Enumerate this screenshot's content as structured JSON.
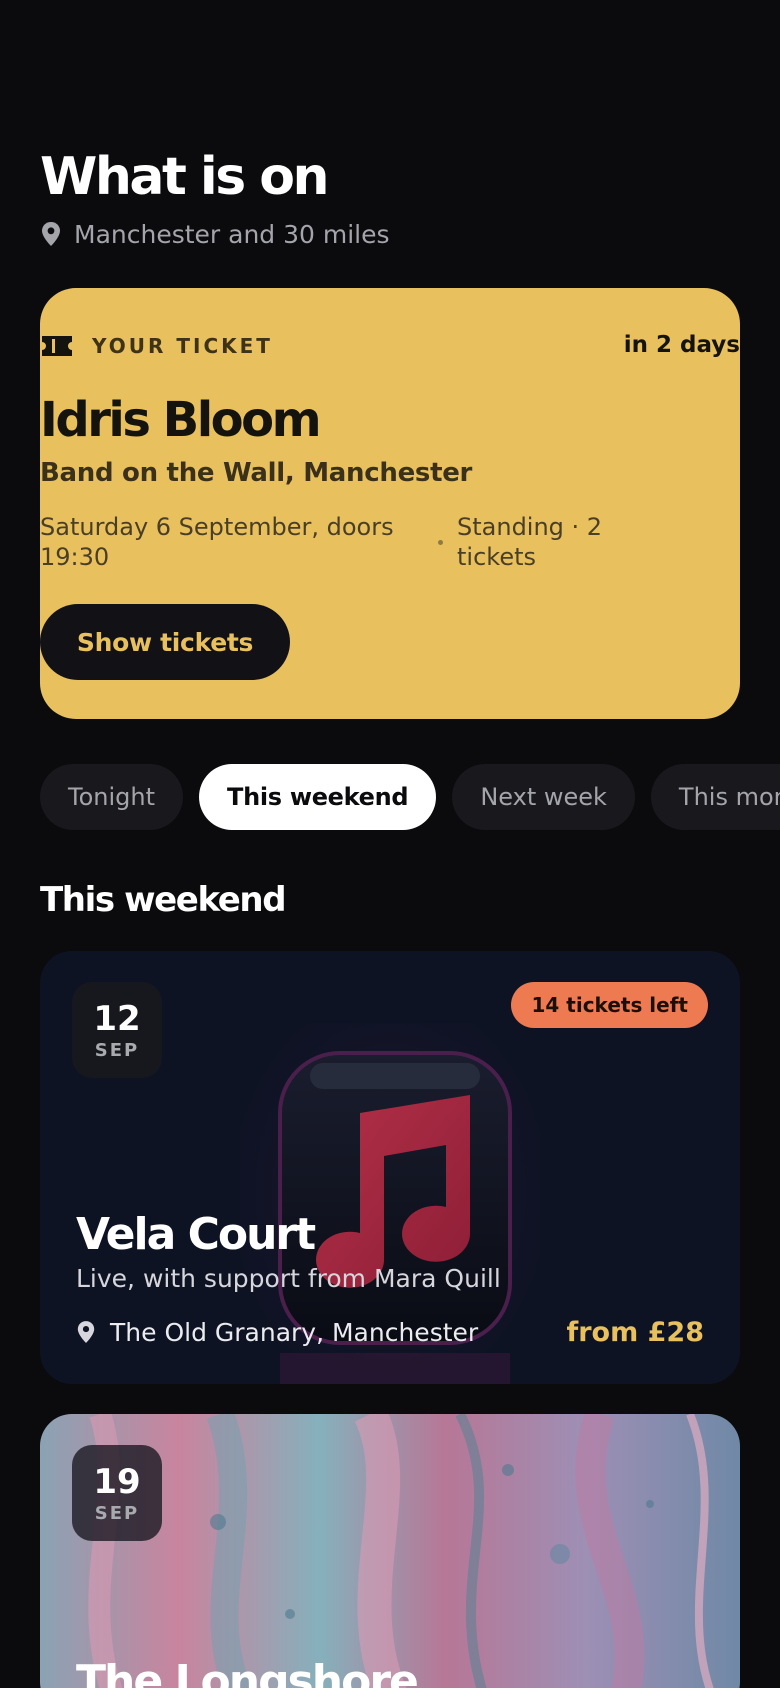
{
  "header": {
    "title": "What is on",
    "location": "Manchester and 30 miles"
  },
  "ticket": {
    "label": "YOUR TICKET",
    "when": "in 2 days",
    "artist": "Idris Bloom",
    "venue": "Band on the Wall, Manchester",
    "datetime": "Saturday 6 September, doors 19:30",
    "details": "Standing · 2 tickets",
    "button": "Show tickets"
  },
  "filters": [
    {
      "label": "Tonight",
      "active": false
    },
    {
      "label": "This weekend",
      "active": true
    },
    {
      "label": "Next week",
      "active": false
    },
    {
      "label": "This month",
      "active": false
    }
  ],
  "section": {
    "title": "This weekend"
  },
  "events": [
    {
      "day": "12",
      "month": "SEP",
      "availability": "14 tickets left",
      "title": "Vela Court",
      "subtitle": "Live, with support from Mara Quill",
      "venue": "The Old Granary, Manchester",
      "price": "from £28"
    },
    {
      "day": "19",
      "month": "SEP",
      "title": "The Longshore"
    }
  ],
  "colors": {
    "background": "#0b0b0e",
    "accent": "#e8c15e",
    "badge": "#ee7a52"
  }
}
